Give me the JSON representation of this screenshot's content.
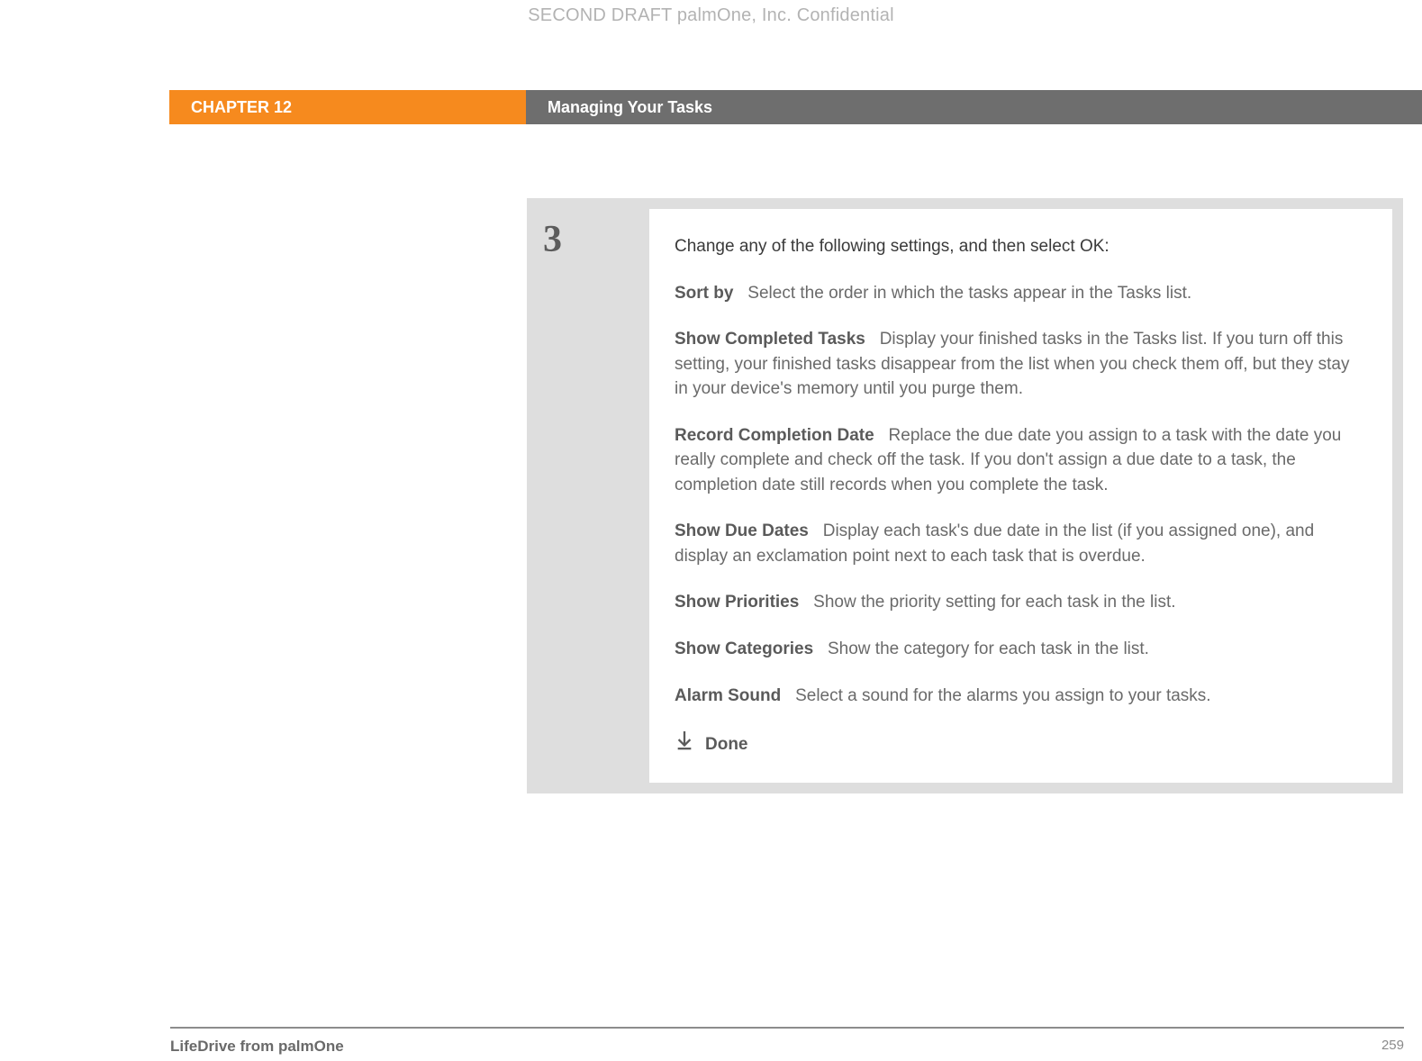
{
  "watermark": "SECOND DRAFT palmOne, Inc.  Confidential",
  "header": {
    "chapter": "CHAPTER 12",
    "title": "Managing Your Tasks"
  },
  "step": {
    "number": "3",
    "lead": "Change any of the following settings, and then select OK:",
    "settings": [
      {
        "label": "Sort by",
        "desc": "Select the order in which the tasks appear in the Tasks list."
      },
      {
        "label": "Show Completed Tasks",
        "desc": "Display your finished tasks in the Tasks list. If you turn off this setting, your finished tasks disappear from the list when you check them off, but they stay in your device's memory until you purge them."
      },
      {
        "label": "Record Completion Date",
        "desc": "Replace the due date you assign to a task with the date you really complete and check off the task. If you don't assign a due date to a task, the completion date still records when you complete the task."
      },
      {
        "label": "Show Due Dates",
        "desc": "Display each task's due date in the list (if you assigned one), and display an exclamation point next to each task that is overdue."
      },
      {
        "label": "Show Priorities",
        "desc": "Show the priority setting for each task in the list."
      },
      {
        "label": "Show Categories",
        "desc": "Show the category for each task in the list."
      },
      {
        "label": "Alarm Sound",
        "desc": "Select a sound for the alarms you assign to your tasks."
      }
    ],
    "done": "Done"
  },
  "footer": {
    "left": "LifeDrive from palmOne",
    "right": "259"
  }
}
